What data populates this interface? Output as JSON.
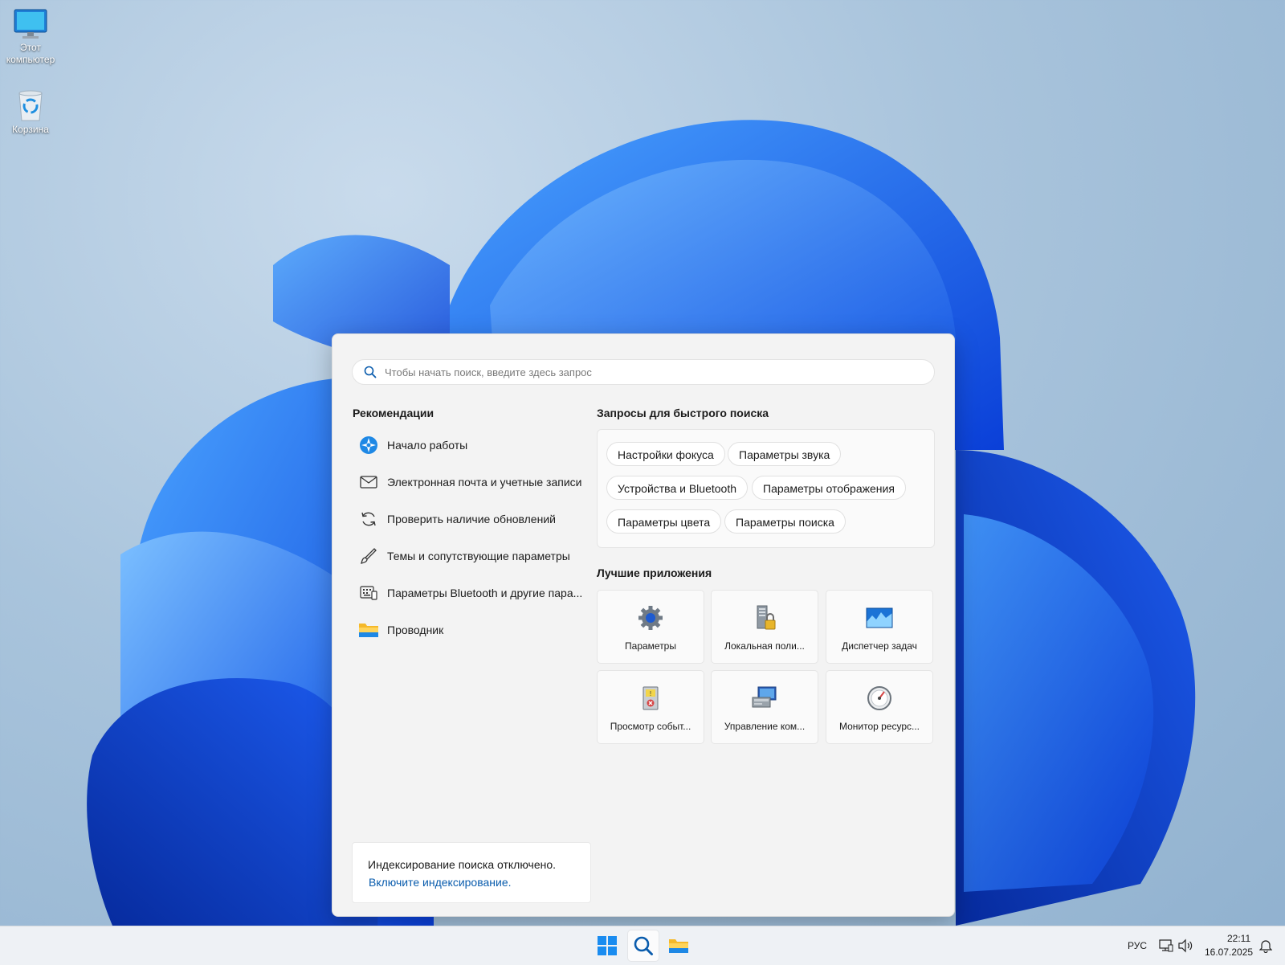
{
  "desktop": {
    "icons": [
      {
        "label": "Этот компьютер",
        "icon": "monitor-icon"
      },
      {
        "label": "Корзина",
        "icon": "recycle-bin-icon"
      }
    ]
  },
  "search": {
    "placeholder": "Чтобы начать поиск, введите здесь запрос",
    "value": ""
  },
  "recommendations": {
    "title": "Рекомендации",
    "items": [
      {
        "label": "Начало работы",
        "icon": "get-started-icon"
      },
      {
        "label": "Электронная почта и учетные записи",
        "icon": "mail-icon"
      },
      {
        "label": "Проверить наличие обновлений",
        "icon": "refresh-icon"
      },
      {
        "label": "Темы и сопутствующие параметры",
        "icon": "brush-icon"
      },
      {
        "label": "Параметры Bluetooth и другие пара...",
        "icon": "keyboard-devices-icon"
      },
      {
        "label": "Проводник",
        "icon": "folder-icon"
      }
    ]
  },
  "quick_search": {
    "title": "Запросы для быстрого поиска",
    "chips": [
      "Настройки фокуса",
      "Параметры звука",
      "Устройства и Bluetooth",
      "Параметры отображения",
      "Параметры цвета",
      "Параметры поиска"
    ]
  },
  "top_apps": {
    "title": "Лучшие приложения",
    "apps": [
      {
        "label": "Параметры",
        "icon": "gear-icon"
      },
      {
        "label": "Локальная поли...",
        "icon": "security-policy-icon"
      },
      {
        "label": "Диспетчер задач",
        "icon": "task-manager-icon"
      },
      {
        "label": "Просмотр событ...",
        "icon": "event-viewer-icon"
      },
      {
        "label": "Управление ком...",
        "icon": "computer-management-icon"
      },
      {
        "label": "Монитор ресурс...",
        "icon": "resource-monitor-icon"
      }
    ]
  },
  "indexing": {
    "text": "Индексирование поиска отключено.",
    "link": "Включите индексирование."
  },
  "taskbar": {
    "language": "РУС",
    "time": "22:11",
    "date": "16.07.2025"
  },
  "colors": {
    "accent": "#0067c0",
    "link": "#0a5cad"
  }
}
